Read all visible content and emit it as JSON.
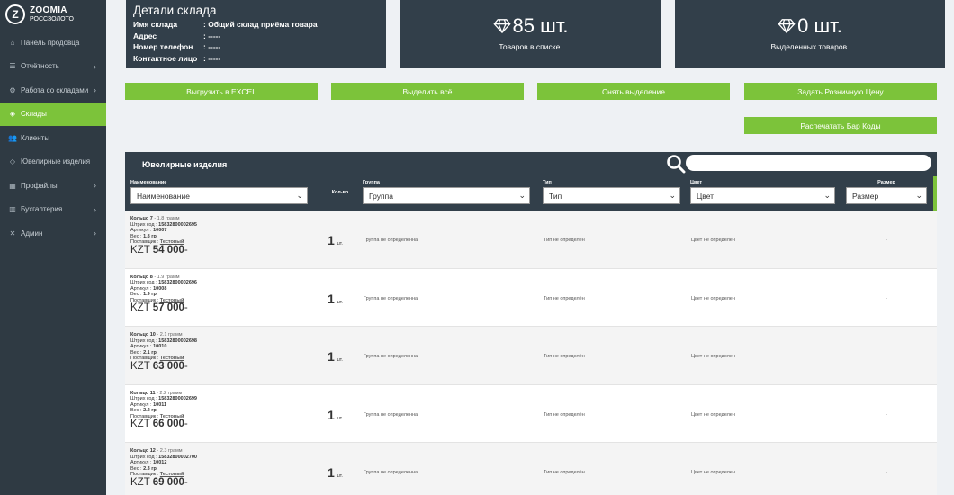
{
  "brand": {
    "logo_letter": "Z",
    "name": "ZOOMIA",
    "subtitle": "РОССЗОЛОТО"
  },
  "sidebar": {
    "items": [
      {
        "label": "Панель продовца",
        "icon": "home-icon",
        "has_chevron": false,
        "active": false
      },
      {
        "label": "Отчётность",
        "icon": "list-icon",
        "has_chevron": true,
        "active": false
      },
      {
        "label": "Работа со складами",
        "icon": "gear-icon",
        "has_chevron": true,
        "active": false
      },
      {
        "label": "Склады",
        "icon": "cube-icon",
        "has_chevron": false,
        "active": true
      },
      {
        "label": "Клиенты",
        "icon": "users-icon",
        "has_chevron": false,
        "active": false
      },
      {
        "label": "Ювелирные изделия",
        "icon": "gem-icon",
        "has_chevron": false,
        "active": false
      },
      {
        "label": "Профайлы",
        "icon": "grid-icon",
        "has_chevron": true,
        "active": false
      },
      {
        "label": "Бухгалтерия",
        "icon": "chart-icon",
        "has_chevron": true,
        "active": false
      },
      {
        "label": "Админ",
        "icon": "tools-icon",
        "has_chevron": true,
        "active": false
      }
    ]
  },
  "warehouse": {
    "title": "Детали склада",
    "fields": [
      {
        "key": "Имя склада",
        "value": ": Общий склад приёма товара"
      },
      {
        "key": "Адрес",
        "value": ": -----"
      },
      {
        "key": "Номер телефон",
        "value": ": -----"
      },
      {
        "key": "Контактное лицо",
        "value": ": -----"
      }
    ]
  },
  "stats": {
    "in_list": {
      "value": "85 шт.",
      "label": "Товаров в списке."
    },
    "selected": {
      "value": "0 шт.",
      "label": "Выделенных товаров."
    }
  },
  "buttons": {
    "export_excel": "Выгрузить в EXCEL",
    "select_all": "Выделить всё",
    "deselect": "Снять выделение",
    "set_retail_price": "Задать Розничную Цену",
    "print_barcodes": "Распечатать Бар Коды"
  },
  "table": {
    "title": "Ювелирные изделия",
    "search_placeholder": "",
    "columns": {
      "name": {
        "label": "Наименование",
        "select": "Наименование"
      },
      "qty": {
        "label": "Кол-во"
      },
      "group": {
        "label": "Группа",
        "select": "Группа"
      },
      "type": {
        "label": "Тип",
        "select": "Тип"
      },
      "color": {
        "label": "Цвет",
        "select": "Цвет"
      },
      "size": {
        "label": "Размер",
        "select": "Размер"
      }
    },
    "rows": [
      {
        "name": "Кольцо 7",
        "weight_note": " - 1.8 грамм",
        "barcode": "15832800002695",
        "article": "10007",
        "weight": "1.8 гр.",
        "supplier": "Тестовый",
        "currency": "KZT",
        "price": "54 000",
        "price_suffix": "-",
        "qty": "1",
        "qty_unit": "шт.",
        "group": "Группа не определенна",
        "type": "Тип не определён",
        "color": "Цвет не определен",
        "size": "-"
      },
      {
        "name": "Кольцо 8",
        "weight_note": " - 1.9 грамм",
        "barcode": "15832800002696",
        "article": "10008",
        "weight": "1.9 гр.",
        "supplier": "Тестовый",
        "currency": "KZT",
        "price": "57 000",
        "price_suffix": "-",
        "qty": "1",
        "qty_unit": "шт.",
        "group": "Группа не определенна",
        "type": "Тип не определён",
        "color": "Цвет не определен",
        "size": "-"
      },
      {
        "name": "Кольцо 10",
        "weight_note": " - 2.1 грамм",
        "barcode": "15832800002698",
        "article": "10010",
        "weight": "2.1 гр.",
        "supplier": "Тестовый",
        "currency": "KZT",
        "price": "63 000",
        "price_suffix": "-",
        "qty": "1",
        "qty_unit": "шт.",
        "group": "Группа не определенна",
        "type": "Тип не определён",
        "color": "Цвет не определен",
        "size": "-"
      },
      {
        "name": "Кольцо 11",
        "weight_note": " - 2.2 грамм",
        "barcode": "15832800002699",
        "article": "10011",
        "weight": "2.2 гр.",
        "supplier": "Тестовый",
        "currency": "KZT",
        "price": "66 000",
        "price_suffix": "-",
        "qty": "1",
        "qty_unit": "шт.",
        "group": "Группа не определенна",
        "type": "Тип не определён",
        "color": "Цвет не определен",
        "size": "-"
      },
      {
        "name": "Кольцо 12",
        "weight_note": " - 2.3 грамм",
        "barcode": "15832800002700",
        "article": "10012",
        "weight": "2.3 гр.",
        "supplier": "Тестовый",
        "currency": "KZT",
        "price": "69 000",
        "price_suffix": "-",
        "qty": "1",
        "qty_unit": "шт.",
        "group": "Группа не определенна",
        "type": "Тип не определён",
        "color": "Цвет не определен",
        "size": "-"
      }
    ],
    "labels": {
      "barcode": "Штрих код : ",
      "article": "Артикул : ",
      "weight": "Вес : ",
      "supplier": "Поставщик : "
    }
  },
  "colors": {
    "accent": "#7cc33a",
    "dark": "#323f4a",
    "sidebar": "#2f3a43"
  },
  "icons": {
    "stat": "diamond-icon",
    "search": "search-icon"
  }
}
